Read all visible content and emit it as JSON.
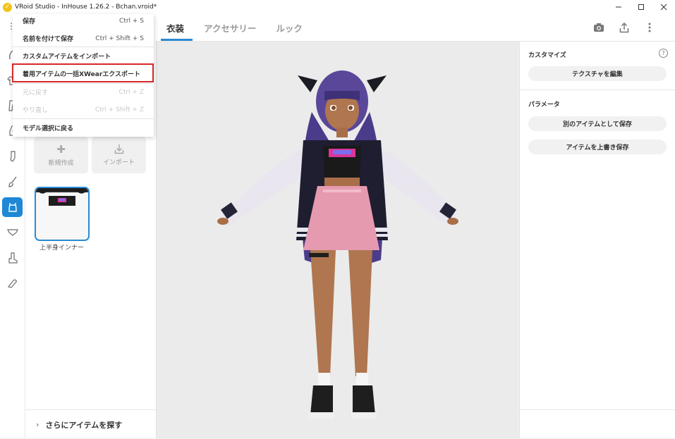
{
  "window": {
    "title": "VRoid Studio - InHouse 1.26.2 - Bchan.vroid*",
    "controls": [
      "minimize",
      "maximize",
      "close"
    ]
  },
  "tabs": [
    {
      "label": "衣装",
      "active": true
    },
    {
      "label": "アクセサリー",
      "active": false
    },
    {
      "label": "ルック",
      "active": false
    }
  ],
  "toolbar_icons": [
    "camera-icon",
    "export-icon",
    "more-vertical-icon"
  ],
  "file_menu": {
    "items": [
      {
        "label": "保存",
        "shortcut": "Ctrl + S",
        "enabled": true
      },
      {
        "label": "名前を付けて保存",
        "shortcut": "Ctrl + Shift + S",
        "enabled": true
      },
      {
        "label": "カスタムアイテムをインポート",
        "shortcut": "",
        "enabled": true
      },
      {
        "label": "着用アイテムの一括XWearエクスポート",
        "shortcut": "",
        "enabled": true,
        "highlighted": true
      },
      {
        "label": "元に戻す",
        "shortcut": "Ctrl + Z",
        "enabled": false
      },
      {
        "label": "やり直し",
        "shortcut": "Ctrl + Shift + Z",
        "enabled": false
      },
      {
        "label": "モデル選択に戻る",
        "shortcut": "",
        "enabled": true
      }
    ]
  },
  "left_panel": {
    "new_button": "新規作成",
    "import_button": "インポート",
    "items": [
      {
        "label": "上半身インナー",
        "selected": true
      }
    ],
    "find_more": "さらにアイテムを探す"
  },
  "right_panel": {
    "customize_heading": "カスタマイズ",
    "edit_texture_button": "テクスチャを編集",
    "parameters_heading": "パラメータ",
    "save_as_new_button": "別のアイテムとして保存",
    "overwrite_button": "アイテムを上書き保存"
  },
  "colors": {
    "accent": "#1e88d6",
    "highlight_box": "#d62828"
  }
}
